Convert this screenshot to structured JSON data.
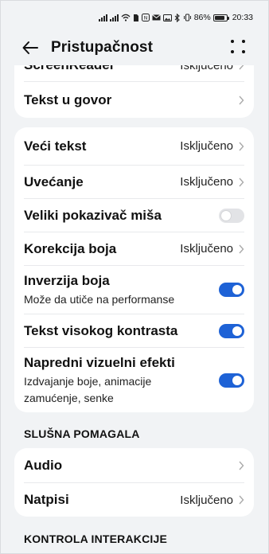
{
  "status_bar": {
    "battery_percent": "86%",
    "time": "20:33",
    "icons": [
      "signal-icon",
      "signal-icon",
      "wifi-icon",
      "sim-icon",
      "nfc-icon",
      "mail-icon",
      "image-icon",
      "bluetooth-icon",
      "vibrate-icon"
    ]
  },
  "header": {
    "title": "Pristupačnost",
    "back_icon": "arrow-left-icon",
    "more_icon": "more-dots-icon"
  },
  "card1": {
    "items": [
      {
        "label": "ScreenReader",
        "value": "Isključeno"
      },
      {
        "label": "Tekst u govor"
      }
    ]
  },
  "card2": {
    "items": [
      {
        "label": "Veći tekst",
        "value": "Isključeno"
      },
      {
        "label": "Uvećanje",
        "value": "Isključeno"
      },
      {
        "label": "Veliki pokazivač miša",
        "toggle": "off"
      },
      {
        "label": "Korekcija boja",
        "value": "Isključeno"
      },
      {
        "label": "Inverzija boja",
        "sub": "Može da utiče na performanse",
        "toggle": "on"
      },
      {
        "label": "Tekst visokog kontrasta",
        "toggle": "on"
      },
      {
        "label": "Napredni vizuelni efekti",
        "sub1": "Izdvajanje boje, animacije",
        "sub2": "zamućenje, senke",
        "toggle": "on"
      }
    ]
  },
  "section_hearing": {
    "title": "SLUŠNA POMAGALA"
  },
  "card3": {
    "items": [
      {
        "label": "Audio"
      },
      {
        "label": "Natpisi",
        "value": "Isključeno"
      }
    ]
  },
  "section_interaction": {
    "title": "KONTROLA INTERAKCIJE"
  },
  "colors": {
    "background": "#f1f3f5",
    "card": "#ffffff",
    "accent": "#1e62d6",
    "toggle_off": "#e2e3e6"
  }
}
